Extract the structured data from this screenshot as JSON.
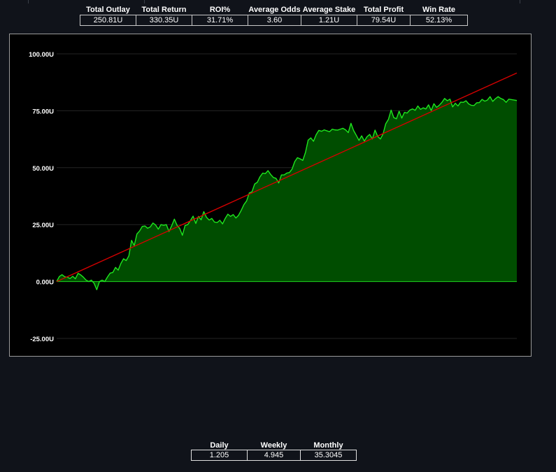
{
  "stats": {
    "headers": [
      "Total Outlay",
      "Total Return",
      "ROI%",
      "Average Odds",
      "Average Stake",
      "Total Profit",
      "Win Rate"
    ],
    "values": [
      "250.81U",
      "330.35U",
      "31.71%",
      "3.60",
      "1.21U",
      "79.54U",
      "52.13%"
    ]
  },
  "rates": {
    "headers": [
      "Daily",
      "Weekly",
      "Monthly"
    ],
    "values": [
      "1.205",
      "4.945",
      "35.3045"
    ]
  },
  "chart_data": {
    "type": "area",
    "title": "",
    "xlabel": "",
    "ylabel": "",
    "ylim": [
      -25,
      100
    ],
    "yticks": [
      100,
      75,
      50,
      25,
      0,
      -25
    ],
    "ytick_labels": [
      "100.00U",
      "75.00U",
      "50.00U",
      "25.00U",
      "0.00U",
      "-25.00U"
    ],
    "grid": true,
    "series": [
      {
        "kind": "area",
        "color": "#1ee61e",
        "fill": "#004d00",
        "values": [
          0.0,
          2.2,
          3.0,
          2.1,
          1.9,
          1.3,
          2.3,
          1.2,
          3.6,
          2.9,
          1.9,
          0.6,
          0.0,
          0.6,
          -0.8,
          -3.6,
          0.0,
          0.6,
          0.0,
          2.0,
          3.7,
          4.0,
          6.2,
          5.0,
          7.9,
          10.0,
          9.2,
          11.3,
          18.1,
          15.8,
          20.9,
          22.2,
          24.2,
          24.4,
          23.4,
          24.0,
          25.7,
          24.8,
          23.0,
          25.0,
          24.7,
          25.0,
          22.0,
          24.5,
          27.4,
          24.7,
          23.3,
          20.3,
          24.6,
          25.0,
          26.8,
          28.7,
          25.5,
          28.6,
          27.1,
          30.7,
          28.2,
          27.0,
          27.7,
          26.1,
          25.9,
          26.9,
          25.3,
          27.7,
          29.6,
          28.6,
          29.4,
          27.9,
          29.1,
          31.3,
          33.8,
          35.4,
          38.9,
          39.4,
          42.8,
          43.6,
          46.0,
          47.6,
          47.4,
          48.7,
          47.0,
          45.7,
          45.3,
          43.3,
          46.8,
          46.8,
          47.6,
          47.9,
          49.4,
          52.7,
          54.4,
          53.9,
          53.2,
          56.7,
          62.1,
          63.1,
          61.6,
          64.5,
          66.4,
          66.0,
          66.6,
          66.2,
          65.8,
          66.9,
          66.6,
          66.5,
          66.9,
          67.3,
          66.6,
          65.4,
          69.5,
          66.3,
          64.2,
          62.0,
          64.0,
          61.7,
          63.6,
          64.6,
          62.6,
          66.5,
          63.7,
          62.6,
          64.8,
          69.3,
          71.2,
          75.3,
          72.0,
          71.5,
          74.8,
          71.8,
          74.3,
          74.0,
          75.3,
          75.8,
          75.2,
          77.1,
          75.6,
          76.3,
          75.8,
          77.6,
          75.1,
          78.1,
          76.5,
          77.4,
          78.7,
          80.4,
          79.4,
          80.1,
          76.7,
          78.3,
          77.1,
          78.8,
          78.7,
          79.4,
          78.0,
          77.4,
          77.3,
          78.5,
          78.6,
          80.0,
          79.2,
          79.7,
          81.2,
          79.1,
          80.3,
          81.2,
          80.4,
          79.9,
          78.7,
          80.1,
          79.9,
          79.7,
          79.5
        ]
      },
      {
        "kind": "line",
        "color": "#d40000",
        "values": [
          0,
          91.6
        ]
      }
    ]
  }
}
